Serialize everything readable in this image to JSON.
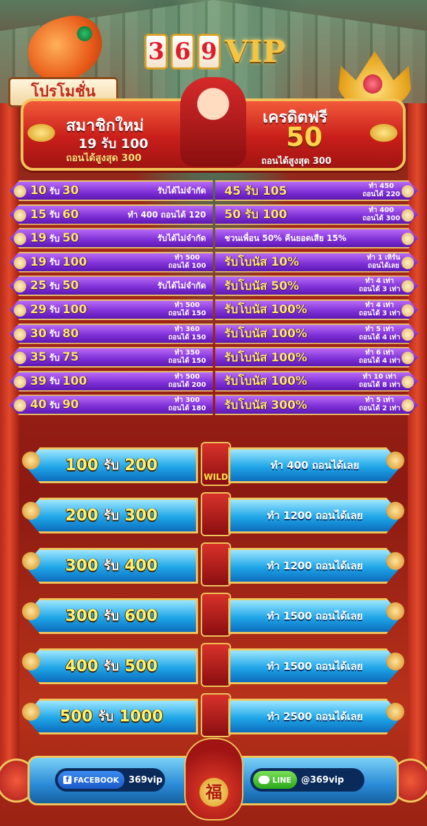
{
  "brand": {
    "digits": [
      "3",
      "6",
      "9"
    ],
    "vip": "VIP"
  },
  "promo_tag": "โปรโมชั่น",
  "hero": {
    "left_title": "สมาชิกใหม่",
    "left_deal": "19 รับ 100",
    "left_note": "ถอนได้สูงสุด 300",
    "right_title": "เครดิตฟรี",
    "right_value": "50",
    "right_note": "ถอนได้สูงสุด 300"
  },
  "purple_rows": [
    {
      "l_dep": "10",
      "l_get": "30",
      "l_note": "รับได้ไม่จำกัด",
      "l_note2": "",
      "r_main": "45 รับ 105",
      "r_note": "ทำ 450",
      "r_note2": "ถอนได้ 220"
    },
    {
      "l_dep": "15",
      "l_get": "60",
      "l_note": "ทำ 400 ถอนได้ 120",
      "l_note2": "",
      "r_main": "50 รับ 100",
      "r_note": "ทำ 400",
      "r_note2": "ถอนได้ 300"
    },
    {
      "l_dep": "19",
      "l_get": "50",
      "l_note": "รับได้ไม่จำกัด",
      "l_note2": "",
      "r_main": "ชวนเพื่อน 50% คืนยอดเสีย 15%",
      "r_note": "",
      "r_note2": ""
    },
    {
      "l_dep": "19",
      "l_get": "100",
      "l_note": "ทำ 500",
      "l_note2": "ถอนได้ 100",
      "r_main": "รับโบนัส 10%",
      "r_note": "ทำ 1 เทิร์น",
      "r_note2": "ถอนได้เลย"
    },
    {
      "l_dep": "25",
      "l_get": "50",
      "l_note": "รับได้ไม่จำกัด",
      "l_note2": "",
      "r_main": "รับโบนัส 50%",
      "r_note": "ทำ 4 เท่า",
      "r_note2": "ถอนได้ 3 เท่า"
    },
    {
      "l_dep": "29",
      "l_get": "100",
      "l_note": "ทำ 500",
      "l_note2": "ถอนได้ 150",
      "r_main": "รับโบนัส 100%",
      "r_note": "ทำ 4 เท่า",
      "r_note2": "ถอนได้ 3 เท่า"
    },
    {
      "l_dep": "30",
      "l_get": "80",
      "l_note": "ทำ 360",
      "l_note2": "ถอนได้ 150",
      "r_main": "รับโบนัส 100%",
      "r_note": "ทำ 5 เท่า",
      "r_note2": "ถอนได้ 4 เท่า"
    },
    {
      "l_dep": "35",
      "l_get": "75",
      "l_note": "ทำ 350",
      "l_note2": "ถอนได้ 150",
      "r_main": "รับโบนัส 100%",
      "r_note": "ทำ 6 เท่า",
      "r_note2": "ถอนได้ 4 เท่า"
    },
    {
      "l_dep": "39",
      "l_get": "100",
      "l_note": "ทำ 500",
      "l_note2": "ถอนได้ 200",
      "r_main": "รับโบนัส 100%",
      "r_note": "ทำ 10 เท่า",
      "r_note2": "ถอนได้ 8 เท่า"
    },
    {
      "l_dep": "40",
      "l_get": "90",
      "l_note": "ทำ 300",
      "l_note2": "ถอนได้ 180",
      "r_main": "รับโบนัส 300%",
      "r_note": "ทำ 5 เท่า",
      "r_note2": "ถอนได้ 2 เท่า"
    }
  ],
  "rub": "รับ",
  "blue_rows": [
    {
      "dep": "100",
      "get": "200",
      "note": "ทำ 400 ถอนได้เลย",
      "symbol": "WILD"
    },
    {
      "dep": "200",
      "get": "300",
      "note": "ทำ 1200 ถอนได้เลย",
      "symbol": ""
    },
    {
      "dep": "300",
      "get": "400",
      "note": "ทำ 1200 ถอนได้เลย",
      "symbol": ""
    },
    {
      "dep": "300",
      "get": "600",
      "note": "ทำ 1500 ถอนได้เลย",
      "symbol": ""
    },
    {
      "dep": "400",
      "get": "500",
      "note": "ทำ 1500 ถอนได้เลย",
      "symbol": ""
    },
    {
      "dep": "500",
      "get": "1000",
      "note": "ทำ 2500 ถอนได้เลย",
      "symbol": ""
    }
  ],
  "footer": {
    "facebook_label": "FACEBOOK",
    "facebook_handle": "369vip",
    "line_label": "LINE",
    "line_handle": "@369vip",
    "bag_glyph": "福"
  }
}
